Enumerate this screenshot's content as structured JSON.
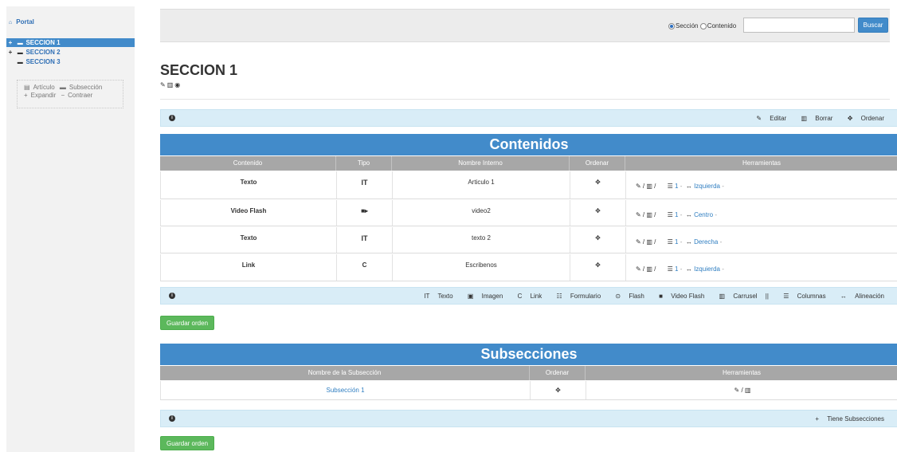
{
  "sidebar": {
    "portal": {
      "icon": "home-icon",
      "label": "Portal"
    },
    "items": [
      {
        "toggle": "+",
        "icon": "folder-open-icon",
        "label": "SECCION 1",
        "selected": true
      },
      {
        "toggle": "+",
        "icon": "folder-icon",
        "label": "SECCION 2",
        "selected": false
      },
      {
        "toggle": "",
        "icon": "folder-icon",
        "label": "SECCION 3",
        "selected": false
      }
    ],
    "legend": {
      "article": "Artículo",
      "subsection": "Subsección",
      "expand": "Expandir",
      "collapse": "Contraer"
    }
  },
  "search": {
    "option_section": "Sección",
    "option_content": "Contenido",
    "selected": "Sección",
    "value": "",
    "button": "Buscar"
  },
  "page": {
    "title": "SECCION 1"
  },
  "section_toolbar": {
    "edit": "Editar",
    "delete": "Borrar",
    "order": "Ordenar"
  },
  "contents": {
    "title": "Contenidos",
    "headers": [
      "Contenido",
      "Tipo",
      "Nombre Interno",
      "Ordenar",
      "Herramientas"
    ],
    "rows": [
      {
        "content": "Texto",
        "type_icon": "text-type-icon",
        "type": "IT",
        "name": "Articulo 1",
        "order": "✥",
        "columns": "1",
        "align": "Izquierda"
      },
      {
        "content": "Video Flash",
        "type_icon": "video-icon",
        "type": "■▸",
        "name": "video2",
        "order": "✥",
        "columns": "1",
        "align": "Centro"
      },
      {
        "content": "Texto",
        "type_icon": "text-type-icon",
        "type": "IT",
        "name": "texto 2",
        "order": "✥",
        "columns": "1",
        "align": "Derecha"
      },
      {
        "content": "Link",
        "type_icon": "link-icon",
        "type": "C",
        "name": "Escribenos",
        "order": "✥",
        "columns": "1",
        "align": "Izquierda"
      }
    ],
    "add_bar": {
      "text": "Texto",
      "image": "Imagen",
      "link": "Link",
      "form": "Formulario",
      "flash": "Flash",
      "video_flash": "Video Flash",
      "carousel": "Carrusel",
      "columns": "Columnas",
      "alignment": "Alineación"
    },
    "save_button": "Guardar orden"
  },
  "subsections": {
    "title": "Subsecciones",
    "headers": [
      "Nombre de la Subsección",
      "Ordenar",
      "Herramientas"
    ],
    "rows": [
      {
        "name": "Subsección 1",
        "order": "✥"
      }
    ],
    "has_subsections": "Tiene Subsecciones",
    "save_button": "Guardar orden"
  },
  "colors": {
    "primary": "#428bca",
    "success": "#5cb85c",
    "info_bg": "#d9edf7",
    "header_gray": "#a7a7a7"
  }
}
